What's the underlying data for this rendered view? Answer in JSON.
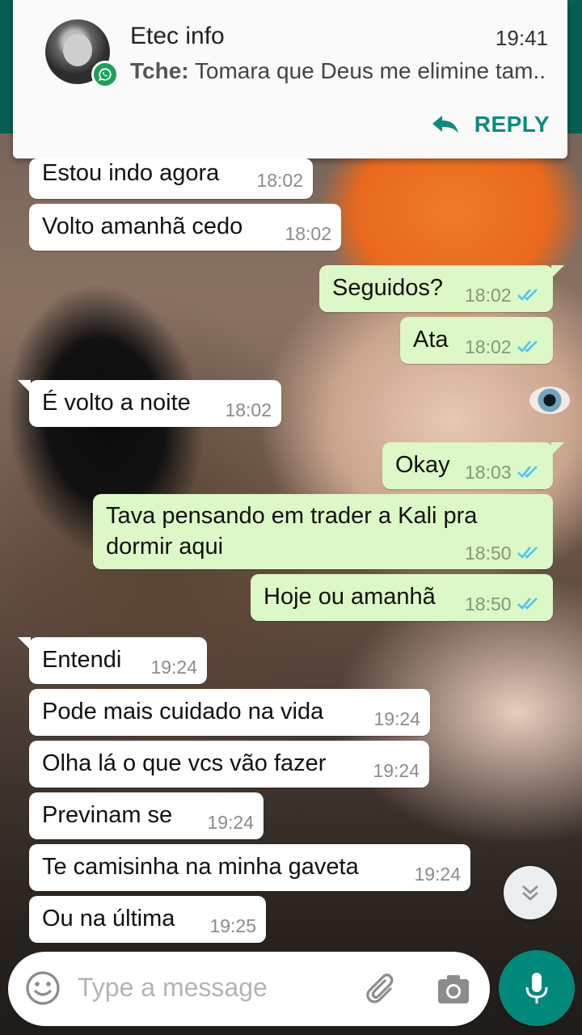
{
  "notification": {
    "title": "Etec info",
    "time": "19:41",
    "sender": "Tche:",
    "message": "Tomara que Deus me elimine tam..",
    "reply_label": "REPLY"
  },
  "messages": [
    {
      "dir": "in",
      "text": "Estou indo agora",
      "time": "18:02"
    },
    {
      "dir": "in",
      "text": "Volto amanhã cedo",
      "time": "18:02"
    },
    {
      "dir": "out",
      "text": "Seguidos?",
      "time": "18:02",
      "status": "read"
    },
    {
      "dir": "out",
      "text": "Ata",
      "time": "18:02",
      "status": "read"
    },
    {
      "dir": "in",
      "text": "É volto a noite",
      "time": "18:02"
    },
    {
      "dir": "out",
      "text": "Okay",
      "time": "18:03",
      "status": "read"
    },
    {
      "dir": "out",
      "text_line1": "Tava pensando em trader a Kali pra",
      "text_line2": "dormir aqui",
      "time": "18:50",
      "status": "read"
    },
    {
      "dir": "out",
      "text": "Hoje ou amanhã",
      "time": "18:50",
      "status": "read"
    },
    {
      "dir": "in",
      "text": "Entendi",
      "time": "19:24"
    },
    {
      "dir": "in",
      "text": "Pode mais cuidado na vida",
      "time": "19:24"
    },
    {
      "dir": "in",
      "text": "Olha lá o que vcs vão fazer",
      "time": "19:24"
    },
    {
      "dir": "in",
      "text": "Previnam se",
      "time": "19:24"
    },
    {
      "dir": "in",
      "text": "Te camisinha na minha gaveta",
      "time": "19:24"
    },
    {
      "dir": "in",
      "text": "Ou na última",
      "time": "19:25"
    }
  ],
  "composer": {
    "placeholder": "Type a message"
  },
  "icons": {
    "emoji": "emoji-icon",
    "attach": "paperclip-icon",
    "camera": "camera-icon",
    "mic": "microphone-icon",
    "scroll": "double-chevron-down-icon",
    "reply": "reply-arrow-icon",
    "read": "double-check-icon"
  },
  "colors": {
    "incoming_bubble": "#ffffff",
    "outgoing_bubble": "#dcf8c6",
    "read_ticks": "#4fc3f7",
    "accent": "#00897b",
    "header": "#075e54"
  }
}
